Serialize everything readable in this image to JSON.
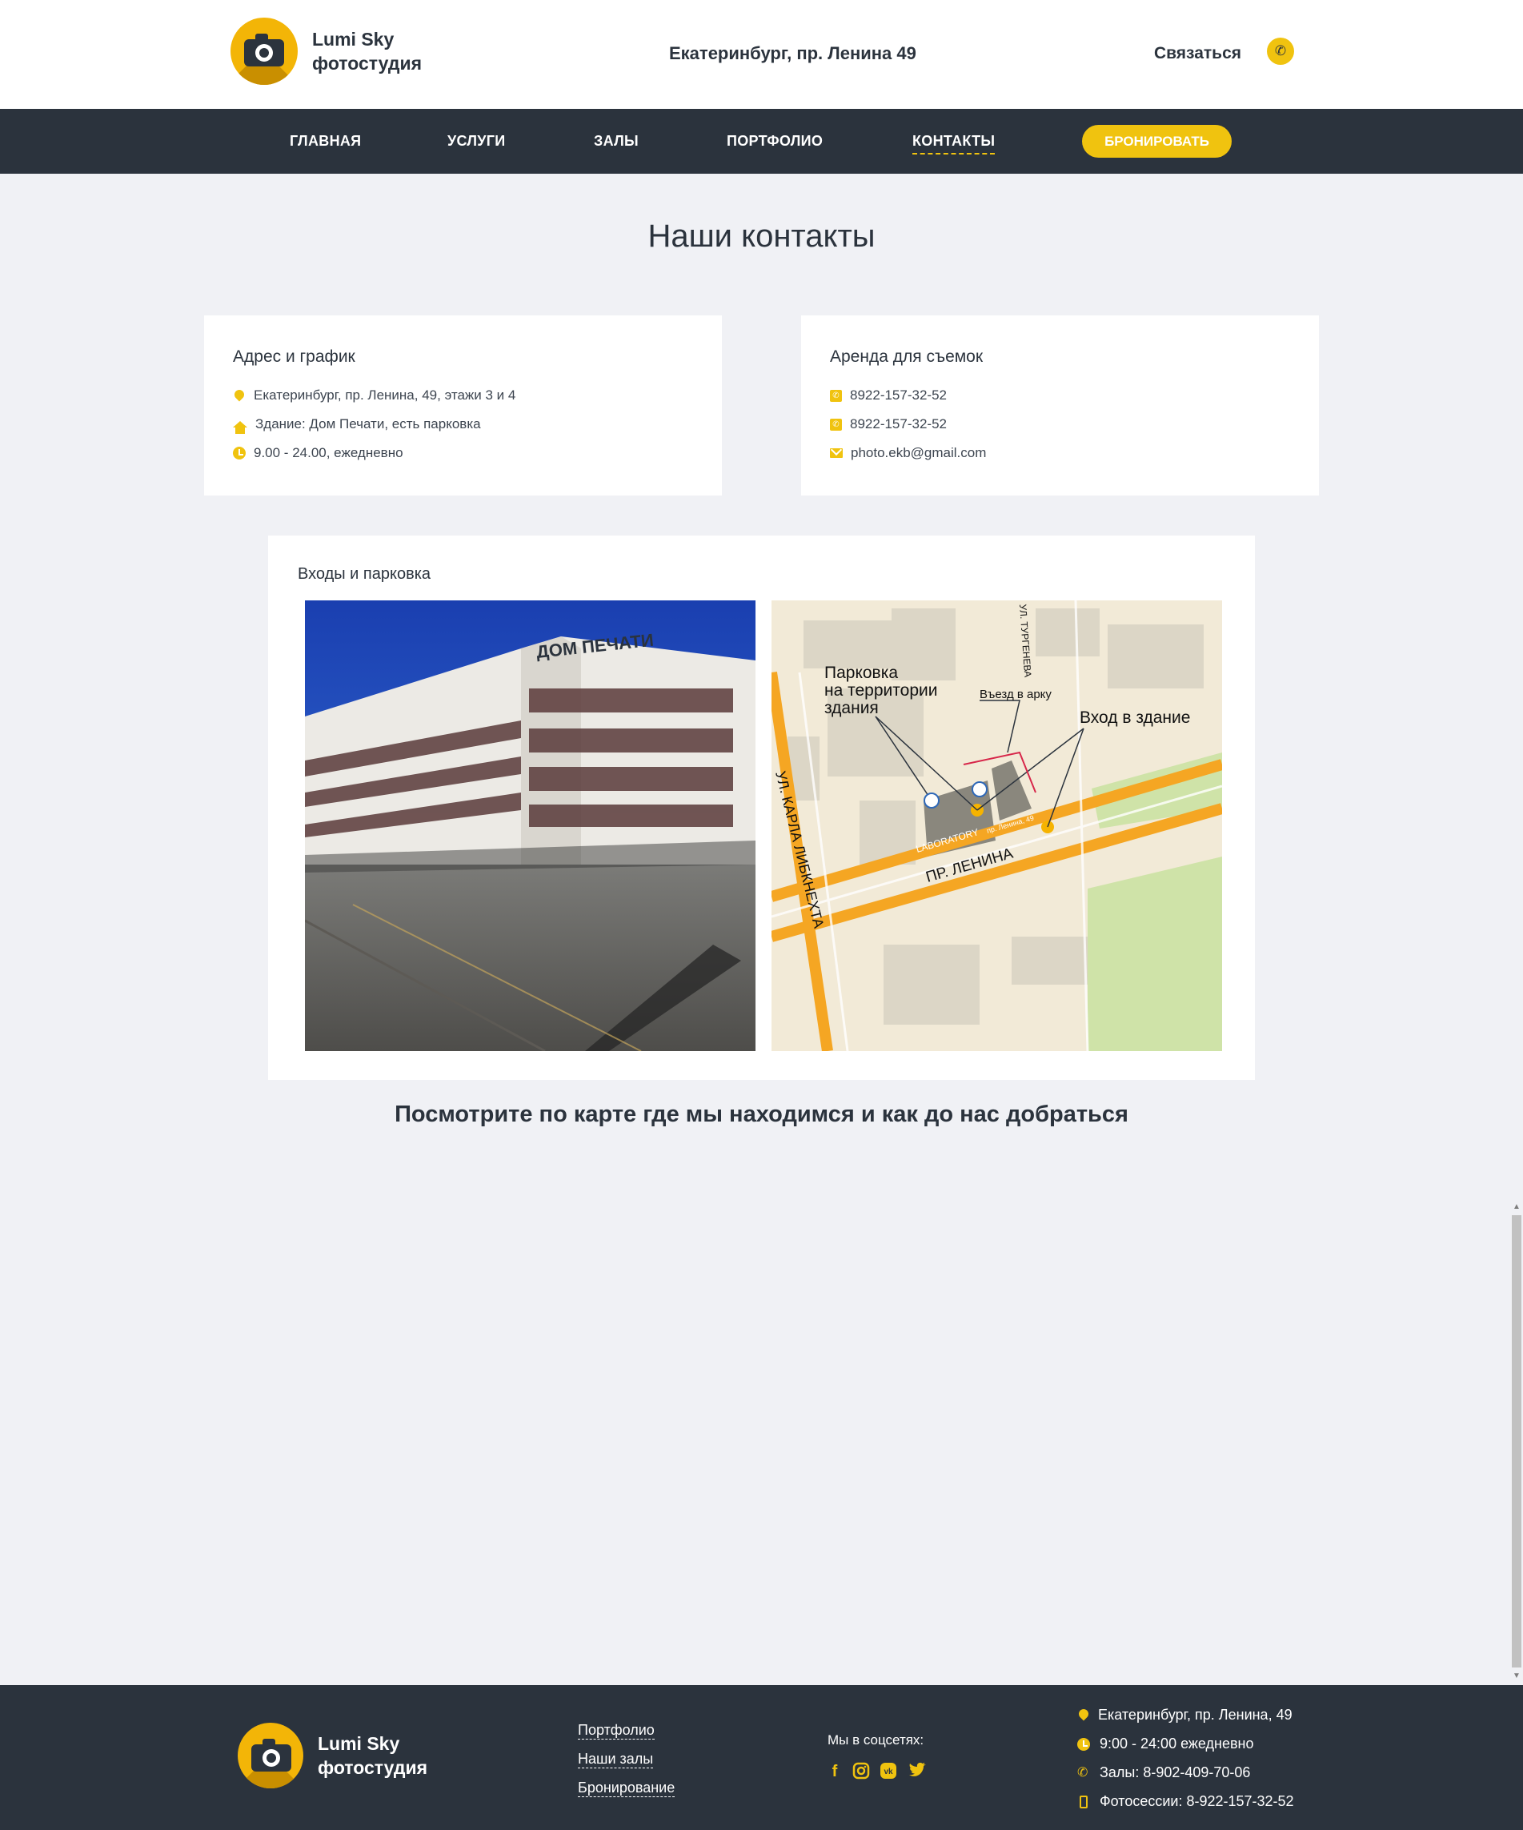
{
  "header": {
    "logo_line1": "Lumi Sky",
    "logo_line2": "фотостудия",
    "address": "Екатеринбург, пр. Ленина 49",
    "contact_label": "Связаться",
    "phone_icon": "phone-icon"
  },
  "nav": {
    "items": [
      {
        "label": "ГЛАВНАЯ"
      },
      {
        "label": "УСЛУГИ"
      },
      {
        "label": "ЗАЛЫ"
      },
      {
        "label": "ПОРТФОЛИО"
      },
      {
        "label": "КОНТАКТЫ",
        "active": true
      }
    ],
    "book_label": "БРОНИРОВАТЬ"
  },
  "page_title": "Наши контакты",
  "address_card": {
    "title": "Адрес и график",
    "rows": [
      {
        "icon": "map-pin-icon",
        "text": "Екатеринбург, пр. Ленина, 49, этажи 3 и 4"
      },
      {
        "icon": "home-icon",
        "text": "Здание: Дом Печати, есть парковка"
      },
      {
        "icon": "clock-icon",
        "text": "9.00 - 24.00, ежедневно"
      }
    ]
  },
  "rent_card": {
    "title": "Аренда для съемок",
    "rows": [
      {
        "icon": "phone-icon",
        "text": "8922-157-32-52"
      },
      {
        "icon": "phone-icon",
        "text": "8922-157-32-52"
      },
      {
        "icon": "mail-icon",
        "text": "photo.ekb@gmail.com"
      }
    ]
  },
  "entrances": {
    "title": "Входы и парковка",
    "photo_sign": "ДОМ ПЕЧАТИ",
    "map": {
      "parking_label_1": "Парковка",
      "parking_label_2": "на территории",
      "parking_label_3": "здания",
      "arch_label": "Въезд в арку",
      "entrance_label": "Вход в здание",
      "street_lenina": "ПР. ЛЕНИНА",
      "street_liebknecht": "УЛ. КАРЛА ЛИБКНЕХТА",
      "street_turgeneva": "УЛ. ТУРГЕНЕВА",
      "building_label": "LABORATORY",
      "building_address": "пр. Ленина, 49"
    }
  },
  "map_heading": "Посмотрите по карте где мы находимся и как до нас добраться",
  "footer": {
    "logo_line1": "Lumi Sky",
    "logo_line2": "фотостудия",
    "links": [
      "Портфолио",
      "Наши залы",
      "Бронирование"
    ],
    "social_label": "Мы в соцсетях:",
    "social_icons": [
      "facebook-icon",
      "instagram-icon",
      "vk-icon",
      "twitter-icon"
    ],
    "info": [
      {
        "icon": "map-pin-icon",
        "text": "Екатеринбург, пр. Ленина, 49"
      },
      {
        "icon": "clock-icon",
        "text": "9:00 - 24:00 ежедневно"
      },
      {
        "icon": "phone-icon",
        "text": "Залы: 8-902-409-70-06"
      },
      {
        "icon": "mobile-icon",
        "text": "Фотосессии: 8-922-157-32-52"
      }
    ]
  },
  "colors": {
    "accent": "#f0c30f",
    "dark": "#2b333d",
    "background": "#f0f1f5"
  }
}
